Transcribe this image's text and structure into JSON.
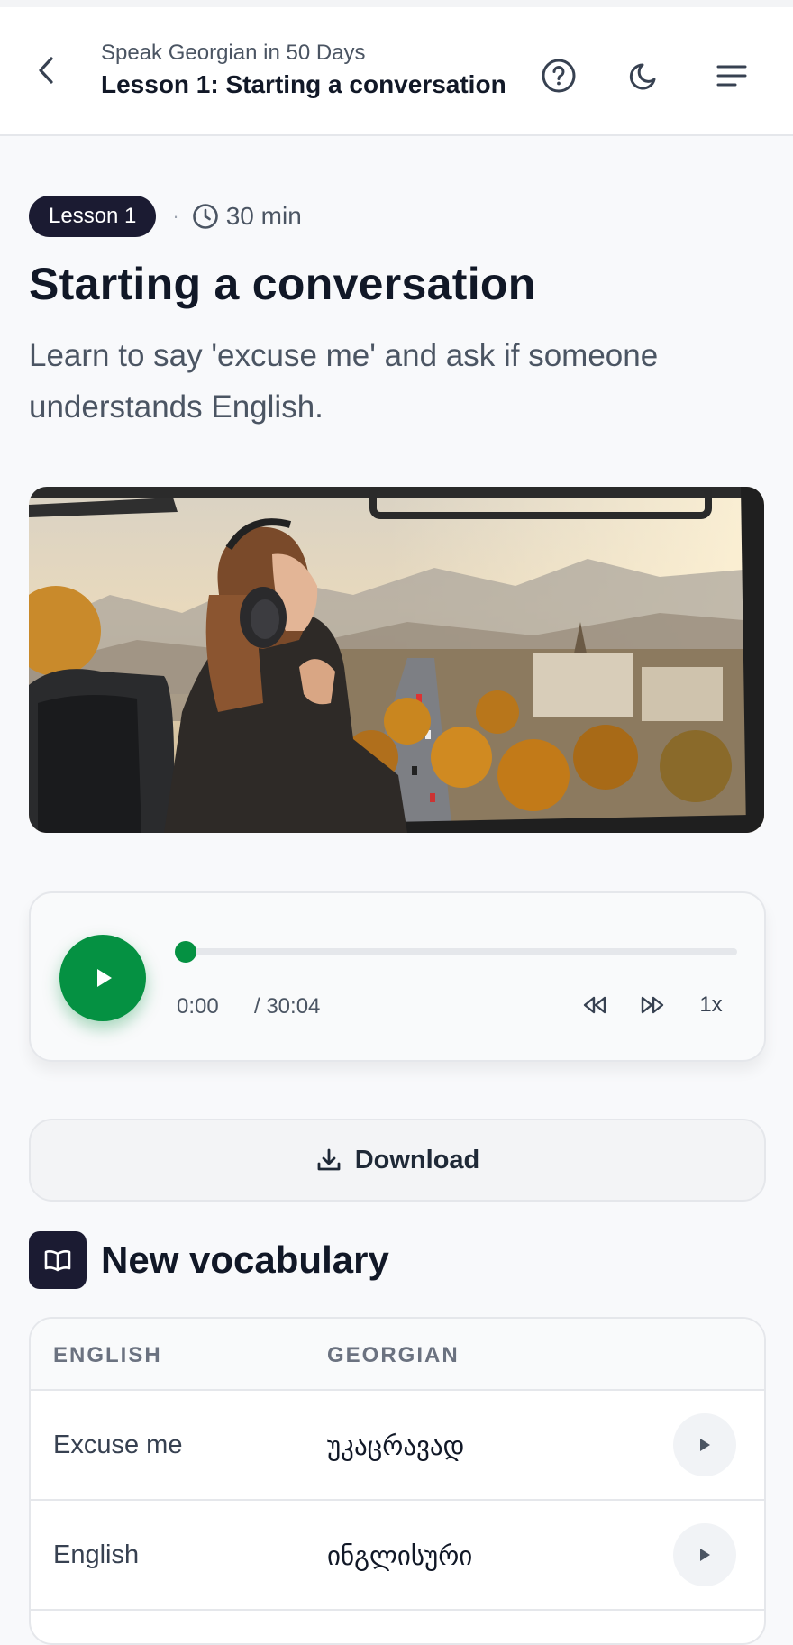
{
  "header": {
    "course_title": "Speak Georgian in 50 Days",
    "lesson_title": "Lesson 1: Starting a conversation"
  },
  "lesson": {
    "badge": "Lesson 1",
    "separator": "·",
    "duration": "30 min",
    "title": "Starting a conversation",
    "description": "Learn to say 'excuse me' and ask if someone understands English."
  },
  "hero_image": {
    "alt": "Woman with headphones looking out a bus window over an autumn city"
  },
  "player": {
    "current_time": "0:00",
    "total_time": "/ 30:04",
    "progress": 0,
    "speed": "1x"
  },
  "download": {
    "label": "Download"
  },
  "vocabulary": {
    "title": "New vocabulary",
    "columns": [
      "ENGLISH",
      "GEORGIAN"
    ],
    "rows": [
      {
        "english": "Excuse me",
        "georgian": "უკაცრავად"
      },
      {
        "english": "English",
        "georgian": "ინგლისური"
      }
    ]
  },
  "colors": {
    "accent_green": "#059142",
    "dark_navy": "#1b1b32",
    "text_muted": "#4b5563"
  },
  "icons": {
    "back": "chevron-left-icon",
    "help": "help-circle-icon",
    "theme": "moon-icon",
    "menu": "menu-icon",
    "clock": "clock-icon",
    "play": "play-icon",
    "rewind": "rewind-icon",
    "forward": "fast-forward-icon",
    "download": "download-icon",
    "book": "book-open-icon"
  }
}
